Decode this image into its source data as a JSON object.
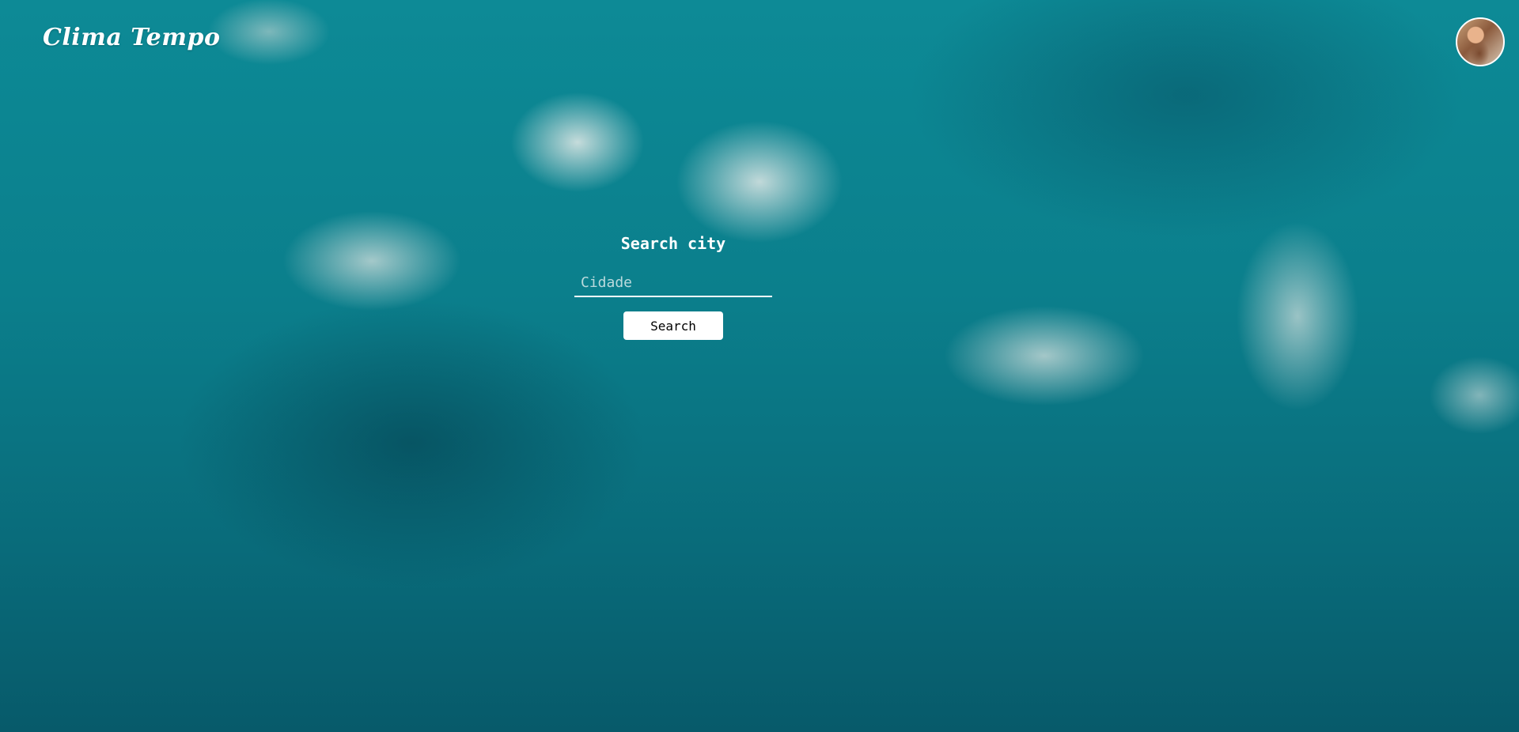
{
  "header": {
    "brand": "Clima Tempo",
    "avatar_icon": "user-avatar"
  },
  "search": {
    "title": "Search city",
    "input_placeholder": "Cidade",
    "input_value": "",
    "button_label": "Search"
  },
  "colors": {
    "background": "#0b7f8c",
    "text": "#ffffff",
    "button_bg": "#ffffff",
    "button_text": "#000000"
  }
}
